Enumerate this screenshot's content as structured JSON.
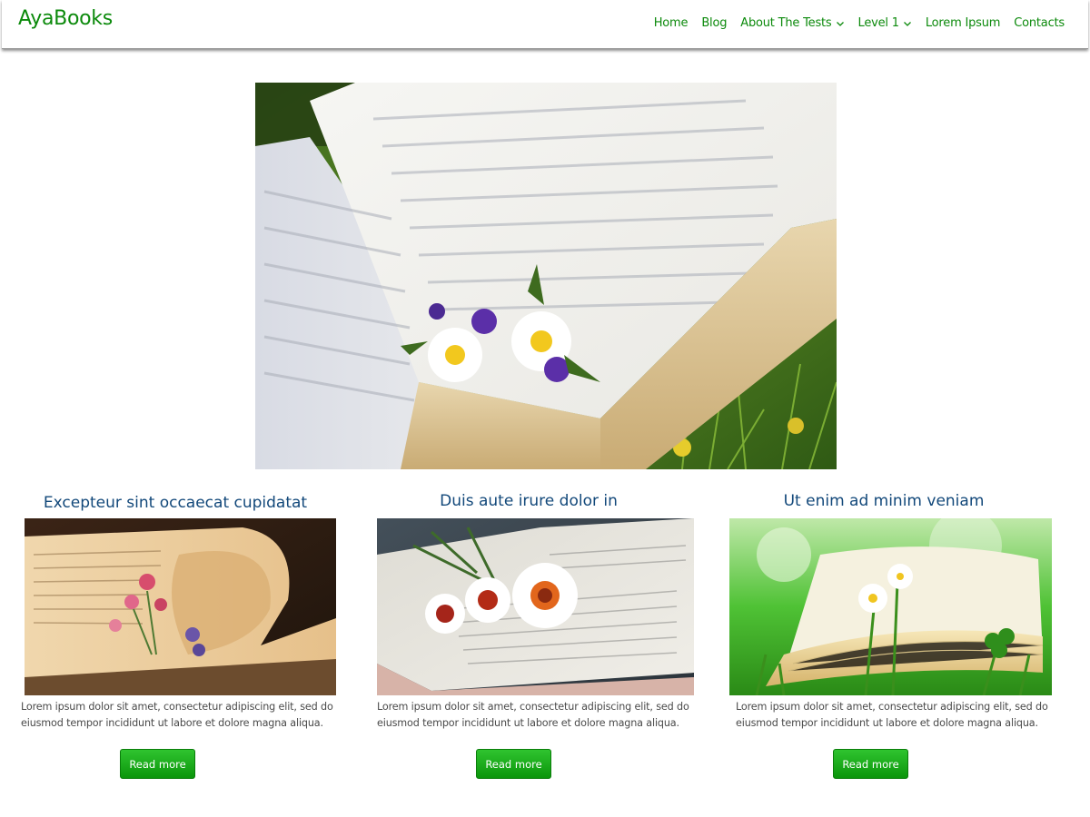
{
  "site": {
    "logo": "AyaBooks"
  },
  "nav": {
    "items": [
      {
        "label": "Home",
        "dropdown": false
      },
      {
        "label": "Blog",
        "dropdown": false
      },
      {
        "label": "About The Tests",
        "dropdown": true
      },
      {
        "label": "Level 1",
        "dropdown": true
      },
      {
        "label": "Lorem Ipsum",
        "dropdown": false
      },
      {
        "label": "Contacts",
        "dropdown": false
      }
    ]
  },
  "hero": {
    "image": "open-book-with-daisies-on-grass"
  },
  "cards": [
    {
      "title": "Excepteur sint occaecat cupidatat",
      "image": "old-book-with-dried-flowers",
      "text": "Lorem ipsum dolor sit amet, consectetur adipiscing elit, sed do eiusmod tempor incididunt ut labore et dolore magna aliqua.",
      "button": "Read more"
    },
    {
      "title": "Duis aute irure dolor in",
      "image": "book-with-white-daisies",
      "text": "Lorem ipsum dolor sit amet, consectetur adipiscing elit, sed do eiusmod tempor incididunt ut labore et dolore magna aliqua.",
      "button": "Read more"
    },
    {
      "title": "Ut enim ad minim veniam",
      "image": "book-in-green-grass",
      "text": "Lorem ipsum dolor sit amet, consectetur adipiscing elit, sed do eiusmod tempor incididunt ut labore et dolore magna aliqua.",
      "button": "Read more"
    }
  ],
  "colors": {
    "brand": "#0c8a0c",
    "title": "#12487a",
    "button": "#18a818",
    "body_text": "#4a4a4a"
  }
}
